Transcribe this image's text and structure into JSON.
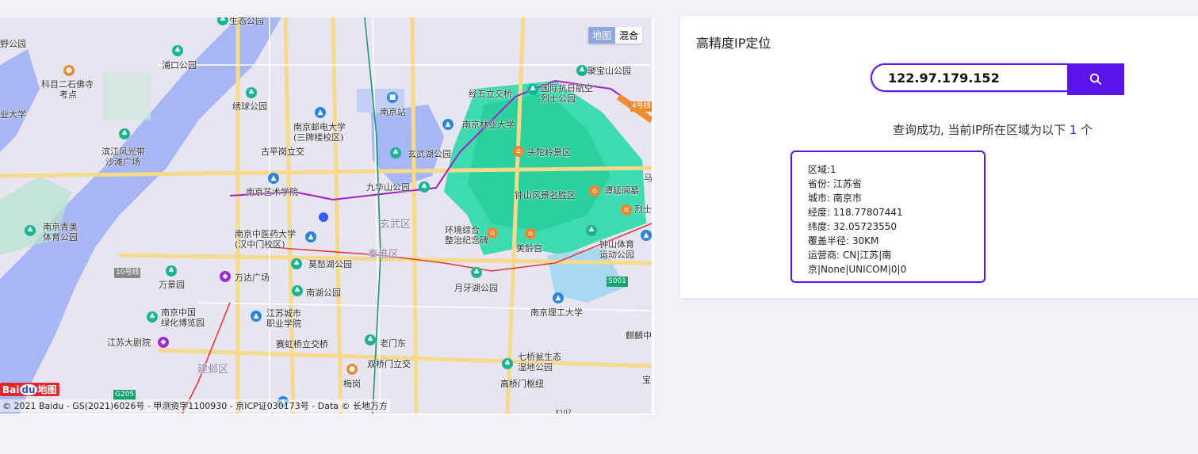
{
  "map": {
    "type_buttons": [
      "地图",
      "混合"
    ],
    "copyright": "© 2021 Baidu - GS(2021)6026号 - 甲测资字1100930 - 京ICP证030173号 - Data © 长地万方",
    "logo_text": "Bai",
    "logo_du": "du",
    "logo_suffix": "地图",
    "labels": {
      "l1": "生态公园",
      "l2": "野公园",
      "l3": "浦口公园",
      "l4": "科目二石佛寺",
      "l5": "考点",
      "l6": "业大学",
      "l7": "绣球公园",
      "l8": "南京邮电大学",
      "l9": "(三牌楼校区)",
      "l10": "南京站",
      "l11": "经五立交桥",
      "l12": "国际抗日航空",
      "l13": "烈士公园",
      "l14": "聚宝山公园",
      "l15": "4号线",
      "l16": "南京林业大学",
      "l17": "滨江风光带",
      "l18": "沙滩广场",
      "l19": "古平岗立交",
      "l20": "玄武湖公园",
      "l21": "头陀岭景区",
      "l22": "九华山公园",
      "l23": "钟山风景名胜区",
      "l24": "谭延闿墓",
      "l25": "南京艺术学院",
      "l26": "南京青奥",
      "l27": "体育公园",
      "l28": "玄武区",
      "l29": "南京中医药大学",
      "l30": "(汉中门校区)",
      "l31": "环境综合",
      "l32": "整治纪念碑",
      "l33": "钟山体育",
      "l34": "运动公园",
      "l35": "秦淮区",
      "l36": "美龄宫",
      "l37": "莫愁湖公园",
      "l38": "10号线",
      "l39": "万达广场",
      "l40": "万景园",
      "l41": "月牙湖公园",
      "l42": "南湖公园",
      "l43": "南京中国",
      "l44": "绿化博览园",
      "l45": "江苏城市",
      "l46": "职业学院",
      "l47": "南京理工大学",
      "l48": "江苏大剧院",
      "l49": "赛虹桥立交桥",
      "l50": "老门东",
      "l51": "麒麟中",
      "l52": "七桥瓮生态",
      "l53": "湿地公园",
      "l54": "双桥门立交",
      "l55": "建邺区",
      "l56": "梅岗",
      "l57": "高桥门枢纽",
      "l58": "烈士",
      "l59": "S001",
      "l60": "G205",
      "l61": "X102",
      "l62": "马",
      "l63": "宝"
    }
  },
  "panel": {
    "title": "高精度IP定位",
    "search_value": "122.97.179.152",
    "result_prefix": "查询成功, 当前IP所在区域为以下 ",
    "result_count": "1",
    "result_suffix": " 个",
    "result": {
      "region": "区域:1",
      "province": "省份: 江苏省",
      "city": "城市: 南京市",
      "longitude": "经度: 118.77807441",
      "latitude": "纬度: 32.05723550",
      "radius": "覆盖半径: 30KM",
      "isp_line1": "运营商: CN|江苏|南",
      "isp_line2": "京|None|UNICOM|0|0"
    }
  },
  "colors": {
    "accent": "#5d14ec",
    "water": "#a7b6f5",
    "park": "#a8e6c8",
    "scenic": "#2fd6a0"
  }
}
